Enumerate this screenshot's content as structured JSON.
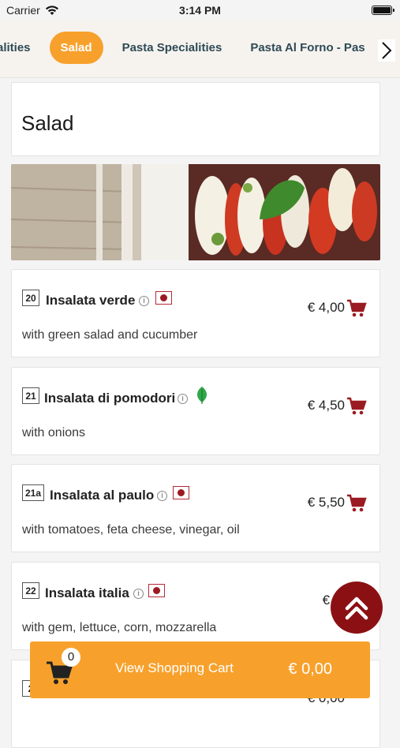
{
  "status": {
    "carrier": "Carrier",
    "time": "3:14 PM"
  },
  "categories": {
    "items": [
      "alities",
      "Salad",
      "Pasta Specialities",
      "Pasta Al Forno - Pas"
    ],
    "active_index": 1,
    "accent_color": "#f7a12c"
  },
  "section": {
    "title": "Salad"
  },
  "menu_items": [
    {
      "number": "20",
      "name": "Insalata verde",
      "badge": "flag-icon",
      "description": "with green salad and cucumber",
      "price": "€ 4,00"
    },
    {
      "number": "21",
      "name": "Insalata di pomodori",
      "badge": "leaf-icon",
      "description": "with onions",
      "price": "€ 4,50"
    },
    {
      "number": "21a",
      "name": "Insalata al paulo",
      "badge": "flag-icon",
      "description": "with tomatoes, feta cheese, vinegar, oil",
      "price": "€ 5,50"
    },
    {
      "number": "22",
      "name": "Insalata italia",
      "badge": "flag-icon",
      "description": "with gem, lettuce, corn, mozzarella",
      "price": "€ 5,"
    },
    {
      "number": "2",
      "name": "",
      "badge": "",
      "description": "",
      "price": "€ 0,00"
    }
  ],
  "cart": {
    "count": "0",
    "label": "View Shopping Cart",
    "total": "€ 0,00"
  },
  "colors": {
    "accent": "#f7a12c",
    "cart_red": "#9b1b22",
    "scroll_button": "#8b1014"
  }
}
